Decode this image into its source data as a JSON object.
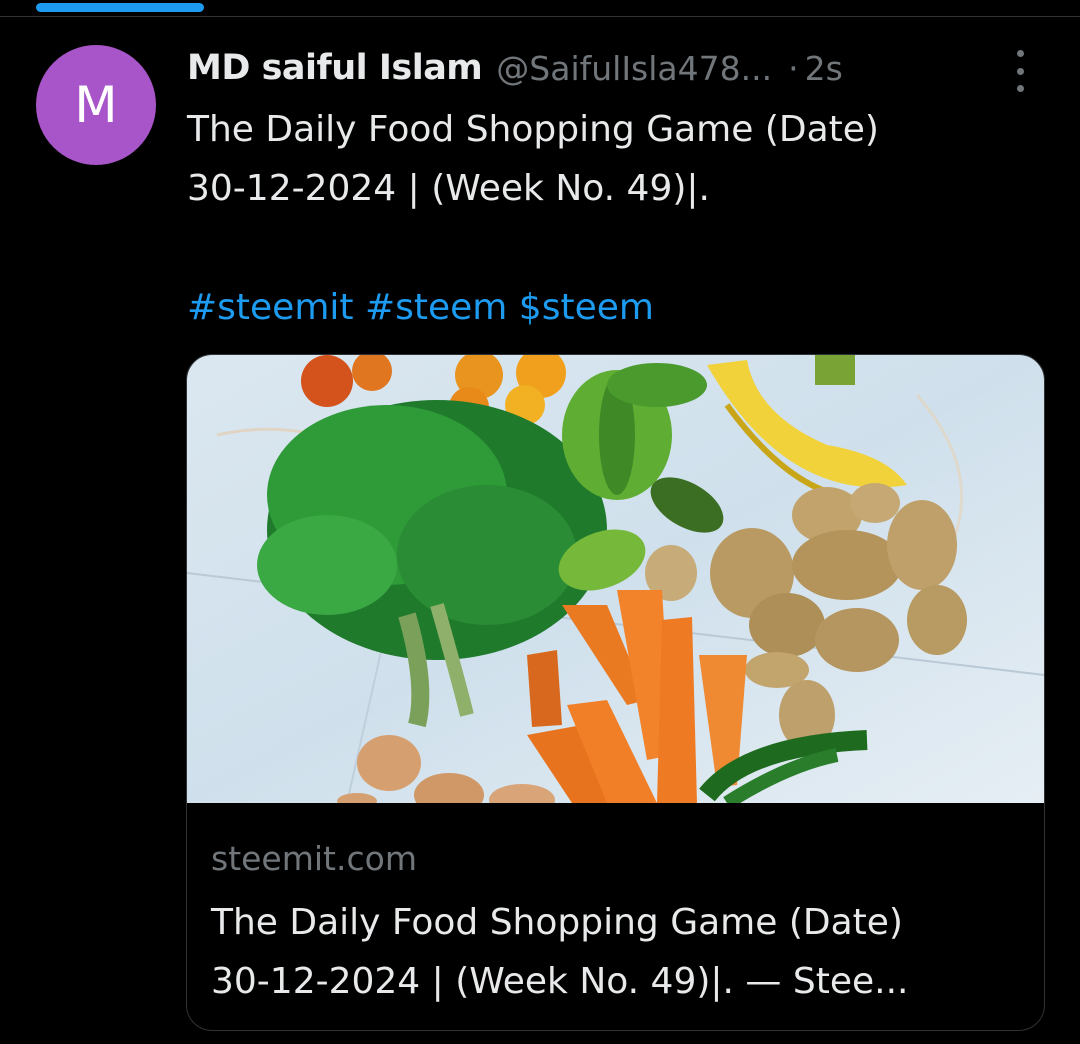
{
  "tweet": {
    "avatar_letter": "M",
    "author_name": "MD saiful Islam",
    "handle": "@SaifulIsla478...",
    "separator": "·",
    "time": "2s",
    "text_line1": "The Daily Food Shopping Game (Date)",
    "text_line2": "30-12-2024 | (Week No. 49)|.",
    "hashtags": "#steemit #steem $steem"
  },
  "card": {
    "domain": "steemit.com",
    "title_line1": "The Daily Food Shopping Game (Date)",
    "title_line2": "30-12-2024 | (Week No. 49)|. — Stee..."
  },
  "colors": {
    "accent": "#1d9bf0",
    "avatar": "#a855c9",
    "background": "#000000",
    "muted_text": "#71767b"
  },
  "icons": {
    "more": "more-vertical-icon"
  }
}
